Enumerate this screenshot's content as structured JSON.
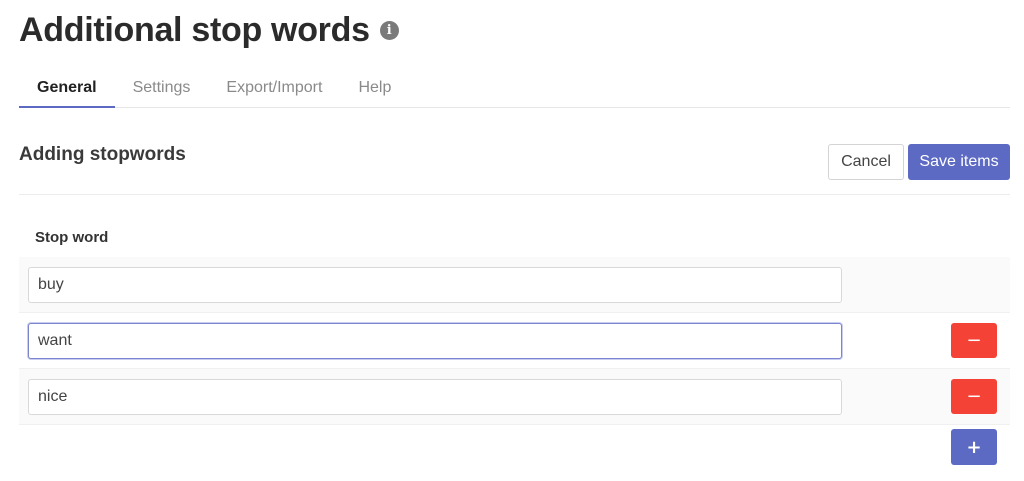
{
  "page": {
    "title": "Additional stop words",
    "info_icon_glyph": "i"
  },
  "tabs": [
    {
      "label": "General",
      "active": true
    },
    {
      "label": "Settings",
      "active": false
    },
    {
      "label": "Export/Import",
      "active": false
    },
    {
      "label": "Help",
      "active": false
    }
  ],
  "section": {
    "title": "Adding stopwords",
    "cancel_label": "Cancel",
    "save_label": "Save items"
  },
  "table": {
    "column_header": "Stop word",
    "rows": [
      {
        "value": "buy"
      },
      {
        "value": "want"
      },
      {
        "value": "nice"
      }
    ],
    "remove_glyph": "−",
    "add_glyph": "+"
  },
  "colors": {
    "accent": "#5c6ac4",
    "danger": "#f44336"
  },
  "icons": {
    "info": "info-icon",
    "remove": "minus-icon",
    "add": "plus-icon"
  }
}
